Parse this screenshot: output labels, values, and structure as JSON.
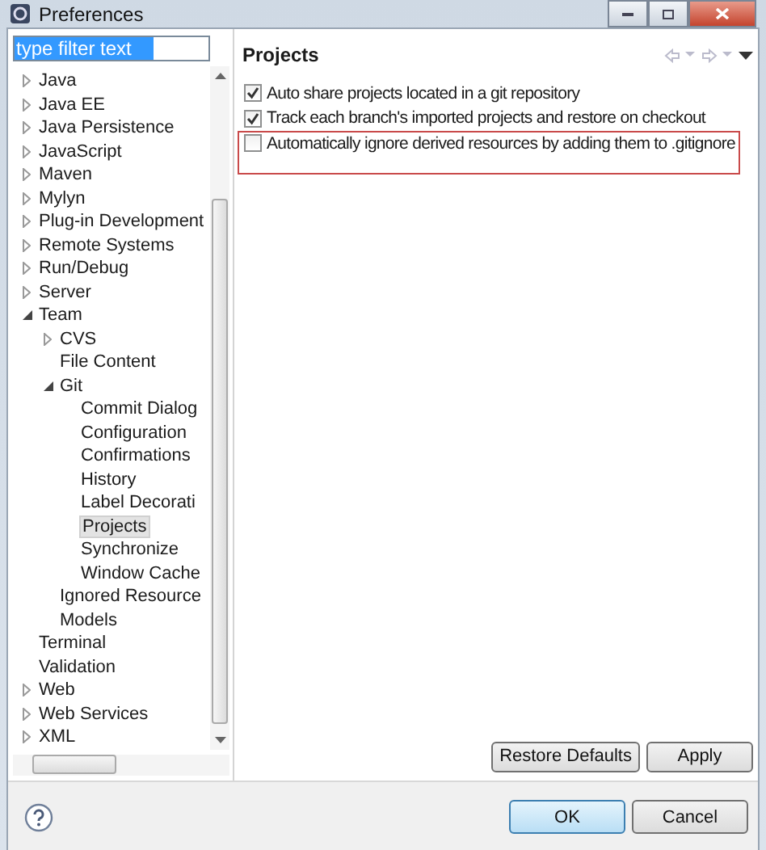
{
  "window": {
    "title": "Preferences"
  },
  "filter": {
    "value": "type filter text"
  },
  "tree": [
    {
      "label": "Java",
      "expandable": true,
      "expanded": false,
      "selected": false
    },
    {
      "label": "Java EE",
      "expandable": true,
      "expanded": false,
      "selected": false
    },
    {
      "label": "Java Persistence",
      "expandable": true,
      "expanded": false,
      "selected": false
    },
    {
      "label": "JavaScript",
      "expandable": true,
      "expanded": false,
      "selected": false
    },
    {
      "label": "Maven",
      "expandable": true,
      "expanded": false,
      "selected": false
    },
    {
      "label": "Mylyn",
      "expandable": true,
      "expanded": false,
      "selected": false
    },
    {
      "label": "Plug-in Development",
      "expandable": true,
      "expanded": false,
      "selected": false
    },
    {
      "label": "Remote Systems",
      "expandable": true,
      "expanded": false,
      "selected": false
    },
    {
      "label": "Run/Debug",
      "expandable": true,
      "expanded": false,
      "selected": false
    },
    {
      "label": "Server",
      "expandable": true,
      "expanded": false,
      "selected": false
    },
    {
      "label": "Team",
      "expandable": true,
      "expanded": true,
      "selected": false,
      "children": [
        {
          "label": "CVS",
          "expandable": true,
          "expanded": false,
          "selected": false
        },
        {
          "label": "File Content",
          "expandable": false,
          "selected": false
        },
        {
          "label": "Git",
          "expandable": true,
          "expanded": true,
          "selected": false,
          "children": [
            {
              "label": "Commit Dialog",
              "expandable": false,
              "selected": false
            },
            {
              "label": "Configuration",
              "expandable": false,
              "selected": false
            },
            {
              "label": "Confirmations",
              "expandable": false,
              "selected": false
            },
            {
              "label": "History",
              "expandable": false,
              "selected": false
            },
            {
              "label": "Label Decorati",
              "expandable": false,
              "selected": false
            },
            {
              "label": "Projects",
              "expandable": false,
              "selected": true
            },
            {
              "label": "Synchronize",
              "expandable": false,
              "selected": false
            },
            {
              "label": "Window Cache",
              "expandable": false,
              "selected": false
            }
          ]
        },
        {
          "label": "Ignored Resource",
          "expandable": false,
          "selected": false
        },
        {
          "label": "Models",
          "expandable": false,
          "selected": false
        }
      ]
    },
    {
      "label": "Terminal",
      "expandable": false,
      "selected": false
    },
    {
      "label": "Validation",
      "expandable": false,
      "selected": false
    },
    {
      "label": "Web",
      "expandable": true,
      "expanded": false,
      "selected": false
    },
    {
      "label": "Web Services",
      "expandable": true,
      "expanded": false,
      "selected": false
    },
    {
      "label": "XML",
      "expandable": true,
      "expanded": false,
      "selected": false
    }
  ],
  "page": {
    "title": "Projects",
    "options": [
      {
        "label": "Auto share projects located in a git repository",
        "checked": true,
        "highlighted": false
      },
      {
        "label": "Track each branch's imported projects and restore on checkout",
        "checked": true,
        "highlighted": false
      },
      {
        "label": "Automatically ignore derived resources by adding them to .gitignore",
        "checked": false,
        "highlighted": true
      }
    ],
    "buttons": [
      "Restore Defaults",
      "Apply"
    ]
  },
  "dialog_buttons": [
    {
      "label": "OK",
      "default": true
    },
    {
      "label": "Cancel",
      "default": false
    }
  ]
}
